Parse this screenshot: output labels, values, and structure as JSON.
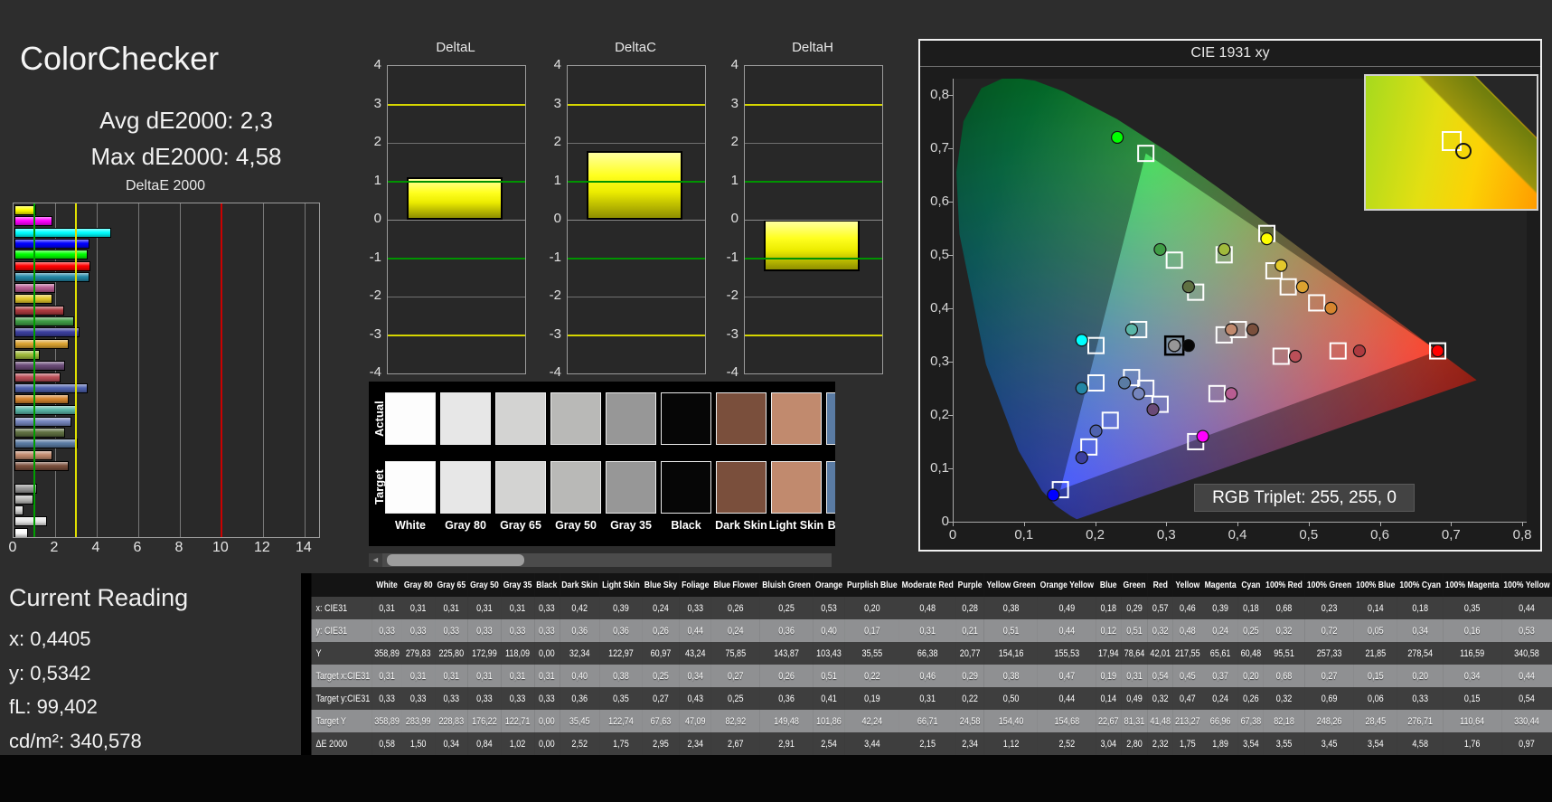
{
  "header": {
    "title": "ColorChecker",
    "avg": "Avg dE2000: 2,3",
    "max": "Max dE2000: 4,58"
  },
  "current_reading": {
    "title": "Current Reading",
    "lines": [
      "x: 0,4405",
      "y: 0,5342",
      "fL: 99,402",
      "cd/m²: 340,578"
    ]
  },
  "deltaE_chart": {
    "title": "DeltaE 2000",
    "x_ticks": [
      0,
      2,
      4,
      6,
      8,
      10,
      12,
      14
    ],
    "xmax": 14.7,
    "green_line": 1,
    "yellow_line": 3,
    "red_line": 10,
    "green_color": "#00a000",
    "yellow_color": "#e0e000",
    "red_color": "#cc0000"
  },
  "delta_charts": [
    {
      "title": "DeltaL",
      "value": 1.1
    },
    {
      "title": "DeltaC",
      "value": 1.8
    },
    {
      "title": "DeltaH",
      "value": -1.35
    }
  ],
  "delta_axis": {
    "ticks": [
      4,
      3,
      2,
      1,
      0,
      -1,
      -2,
      -3,
      -4
    ],
    "yellow_lines": [
      3,
      -3
    ],
    "green_lines": [
      1,
      -1
    ]
  },
  "swatch_panel": {
    "row_labels": [
      "Actual",
      "Target"
    ]
  },
  "cie": {
    "title": "CIE 1931 xy",
    "rgb_triplet": "RGB Triplet: 255, 255, 0",
    "x_ticks": [
      "0",
      "0,1",
      "0,2",
      "0,3",
      "0,4",
      "0,5",
      "0,6",
      "0,7",
      "0,8"
    ],
    "y_ticks": [
      "0",
      "0,1",
      "0,2",
      "0,3",
      "0,4",
      "0,5",
      "0,6",
      "0,7",
      "0,8"
    ],
    "x_max": 0.805,
    "y_max": 0.83,
    "gamut_triangle": [
      [
        0.68,
        0.32
      ],
      [
        0.27,
        0.69
      ],
      [
        0.15,
        0.06
      ]
    ]
  },
  "table": {
    "row_labels": [
      "x: CIE31",
      "y: CIE31",
      "Y",
      "Target x:CIE31",
      "Target y:CIE31",
      "Target Y",
      "ΔE 2000"
    ],
    "row_keys": [
      "x",
      "y",
      "Y",
      "tx",
      "ty",
      "tY",
      "dE"
    ]
  },
  "patches": [
    {
      "name": "White",
      "color": "#fdfdfd",
      "x": "0,31",
      "y": "0,33",
      "Y": "358,89",
      "tx": "0,31",
      "ty": "0,33",
      "tY": "358,89",
      "dE": "0,58"
    },
    {
      "name": "Gray 80",
      "color": "#e7e7e7",
      "x": "0,31",
      "y": "0,33",
      "Y": "279,83",
      "tx": "0,31",
      "ty": "0,33",
      "tY": "283,99",
      "dE": "1,50"
    },
    {
      "name": "Gray 65",
      "color": "#d3d3d2",
      "x": "0,31",
      "y": "0,33",
      "Y": "225,80",
      "tx": "0,31",
      "ty": "0,33",
      "tY": "228,83",
      "dE": "0,34"
    },
    {
      "name": "Gray 50",
      "color": "#b9b9b7",
      "x": "0,31",
      "y": "0,33",
      "Y": "172,99",
      "tx": "0,31",
      "ty": "0,33",
      "tY": "176,22",
      "dE": "0,84"
    },
    {
      "name": "Gray 35",
      "color": "#979797",
      "x": "0,31",
      "y": "0,33",
      "Y": "118,09",
      "tx": "0,31",
      "ty": "0,33",
      "tY": "122,71",
      "dE": "1,02"
    },
    {
      "name": "Black",
      "color": "#060606",
      "x": "0,33",
      "y": "0,33",
      "Y": "0,00",
      "tx": "0,31",
      "ty": "0,33",
      "tY": "0,00",
      "dE": "0,00"
    },
    {
      "name": "Dark Skin",
      "color": "#7a4f3c",
      "x": "0,42",
      "y": "0,36",
      "Y": "32,34",
      "tx": "0,40",
      "ty": "0,36",
      "tY": "35,45",
      "dE": "2,52"
    },
    {
      "name": "Light Skin",
      "color": "#c18a6e",
      "x": "0,39",
      "y": "0,36",
      "Y": "122,97",
      "tx": "0,38",
      "ty": "0,35",
      "tY": "122,74",
      "dE": "1,75"
    },
    {
      "name": "Blue Sky",
      "color": "#5a7ba3",
      "x": "0,24",
      "y": "0,26",
      "Y": "60,97",
      "tx": "0,25",
      "ty": "0,27",
      "tY": "67,63",
      "dE": "2,95"
    },
    {
      "name": "Foliage",
      "color": "#5f7042",
      "x": "0,33",
      "y": "0,44",
      "Y": "43,24",
      "tx": "0,34",
      "ty": "0,43",
      "tY": "47,09",
      "dE": "2,34"
    },
    {
      "name": "Blue Flower",
      "color": "#7585bd",
      "x": "0,26",
      "y": "0,24",
      "Y": "75,85",
      "tx": "0,27",
      "ty": "0,25",
      "tY": "82,92",
      "dE": "2,67"
    },
    {
      "name": "Bluish Green",
      "color": "#59b6a7",
      "x": "0,25",
      "y": "0,36",
      "Y": "143,87",
      "tx": "0,26",
      "ty": "0,36",
      "tY": "149,48",
      "dE": "2,91"
    },
    {
      "name": "Orange",
      "color": "#d6852e",
      "x": "0,53",
      "y": "0,40",
      "Y": "103,43",
      "tx": "0,51",
      "ty": "0,41",
      "tY": "101,86",
      "dE": "2,54"
    },
    {
      "name": "Purplish Blue",
      "color": "#4f62ae",
      "x": "0,20",
      "y": "0,17",
      "Y": "35,55",
      "tx": "0,22",
      "ty": "0,19",
      "tY": "42,24",
      "dE": "3,44"
    },
    {
      "name": "Moderate Red",
      "color": "#bb4f58",
      "x": "0,48",
      "y": "0,31",
      "Y": "66,38",
      "tx": "0,46",
      "ty": "0,31",
      "tY": "66,71",
      "dE": "2,15"
    },
    {
      "name": "Purple",
      "color": "#6a4a77",
      "x": "0,28",
      "y": "0,21",
      "Y": "20,77",
      "tx": "0,29",
      "ty": "0,22",
      "tY": "24,58",
      "dE": "2,34"
    },
    {
      "name": "Yellow Green",
      "color": "#a0ba3c",
      "x": "0,38",
      "y": "0,51",
      "Y": "154,16",
      "tx": "0,38",
      "ty": "0,50",
      "tY": "154,40",
      "dE": "1,12"
    },
    {
      "name": "Orange Yellow",
      "color": "#dba230",
      "x": "0,49",
      "y": "0,44",
      "Y": "155,53",
      "tx": "0,47",
      "ty": "0,44",
      "tY": "154,68",
      "dE": "2,52"
    },
    {
      "name": "Blue",
      "color": "#3b3f9e",
      "x": "0,18",
      "y": "0,12",
      "Y": "17,94",
      "tx": "0,19",
      "ty": "0,14",
      "tY": "22,67",
      "dE": "3,04"
    },
    {
      "name": "Green",
      "color": "#3f9c45",
      "x": "0,29",
      "y": "0,51",
      "Y": "78,64",
      "tx": "0,31",
      "ty": "0,49",
      "tY": "81,31",
      "dE": "2,80"
    },
    {
      "name": "Red",
      "color": "#ad3a3f",
      "x": "0,57",
      "y": "0,32",
      "Y": "42,01",
      "tx": "0,54",
      "ty": "0,32",
      "tY": "41,48",
      "dE": "2,32"
    },
    {
      "name": "Yellow",
      "color": "#e3c82c",
      "x": "0,46",
      "y": "0,48",
      "Y": "217,55",
      "tx": "0,45",
      "ty": "0,47",
      "tY": "213,27",
      "dE": "1,75"
    },
    {
      "name": "Magenta",
      "color": "#b85d92",
      "x": "0,39",
      "y": "0,24",
      "Y": "65,61",
      "tx": "0,37",
      "ty": "0,24",
      "tY": "66,96",
      "dE": "1,89"
    },
    {
      "name": "Cyan",
      "color": "#2386a5",
      "x": "0,18",
      "y": "0,25",
      "Y": "60,48",
      "tx": "0,20",
      "ty": "0,26",
      "tY": "67,38",
      "dE": "3,54"
    },
    {
      "name": "100% Red",
      "color": "#ff0000",
      "x": "0,68",
      "y": "0,32",
      "Y": "95,51",
      "tx": "0,68",
      "ty": "0,32",
      "tY": "82,18",
      "dE": "3,55"
    },
    {
      "name": "100% Green",
      "color": "#00ff00",
      "x": "0,23",
      "y": "0,72",
      "Y": "257,33",
      "tx": "0,27",
      "ty": "0,69",
      "tY": "248,26",
      "dE": "3,45"
    },
    {
      "name": "100% Blue",
      "color": "#0000ff",
      "x": "0,14",
      "y": "0,05",
      "Y": "21,85",
      "tx": "0,15",
      "ty": "0,06",
      "tY": "28,45",
      "dE": "3,54"
    },
    {
      "name": "100% Cyan",
      "color": "#00ffff",
      "x": "0,18",
      "y": "0,34",
      "Y": "278,54",
      "tx": "0,20",
      "ty": "0,33",
      "tY": "276,71",
      "dE": "4,58"
    },
    {
      "name": "100% Magenta",
      "color": "#ff00ff",
      "x": "0,35",
      "y": "0,16",
      "Y": "116,59",
      "tx": "0,34",
      "ty": "0,15",
      "tY": "110,64",
      "dE": "1,76"
    },
    {
      "name": "100% Yellow",
      "color": "#ffff00",
      "x": "0,44",
      "y": "0,53",
      "Y": "340,58",
      "tx": "0,44",
      "ty": "0,54",
      "tY": "330,44",
      "dE": "0,97"
    }
  ]
}
